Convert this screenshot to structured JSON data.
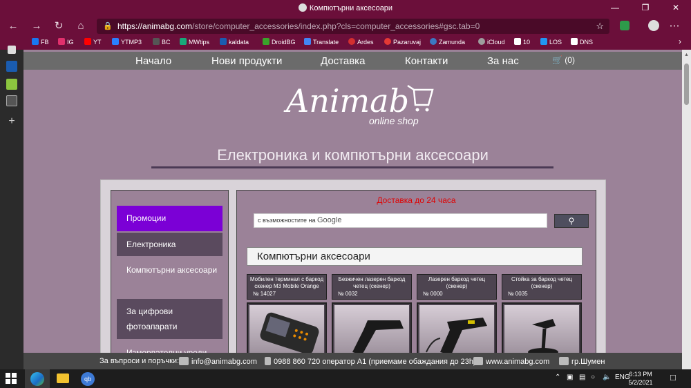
{
  "browser": {
    "tab_title": "Компютърни аксесоари",
    "url_host": "https://animabg.com",
    "url_path": "/store/computer_accessories/index.php?cls=computer_accessories#gsc.tab=0",
    "window_controls": [
      "—",
      "❐",
      "✕"
    ]
  },
  "favorites": [
    {
      "label": "FB",
      "color": "#1877f2"
    },
    {
      "label": "IG",
      "color": "#e1306c"
    },
    {
      "label": "YT",
      "color": "#ff0000"
    },
    {
      "label": "YTMP3",
      "color": "#2a7fff"
    },
    {
      "label": "BC",
      "color": "#555555"
    },
    {
      "label": "MWtips",
      "color": "#18a87a"
    },
    {
      "label": "kaldata",
      "color": "#1a5cb0"
    },
    {
      "label": "DroidBG",
      "color": "#3aa32a"
    },
    {
      "label": "Translate",
      "color": "#4285f4"
    },
    {
      "label": "Ardes",
      "color": "#d32f2f"
    },
    {
      "label": "Pazaruvaj",
      "color": "#e53935"
    },
    {
      "label": "Zamunda",
      "color": "#3b78c2"
    },
    {
      "label": "iCloud",
      "color": "#9e9e9e"
    },
    {
      "label": "10",
      "color": "#ffffff"
    },
    {
      "label": "LOS",
      "color": "#2196f3"
    },
    {
      "label": "DNS",
      "color": "#ffffff"
    }
  ],
  "site": {
    "menu": [
      "Начало",
      "Нови продукти",
      "Доставка",
      "Контакти",
      "За нас"
    ],
    "cart_count": "(0)",
    "logo_main": "Animab",
    "logo_sub": "online shop",
    "headline": "Електроника и компютърни аксесоари",
    "categories": [
      {
        "label": "Промоции",
        "active": true
      },
      {
        "label": "Електроника",
        "active": false
      },
      {
        "label": "Компютърни аксесоари",
        "active": false
      },
      {
        "label": "За цифрови фотоапарати",
        "active": false
      },
      {
        "label": "Измервателни уреди",
        "active": false
      }
    ],
    "delivery_note": "Доставка до 24 часа",
    "search_placeholder": "с възможностите на",
    "search_brand": "Google",
    "section_title": "Компютърни аксесоари",
    "products": [
      {
        "name": "Мобилен терминал с баркод скенер M3 Mobile Orange",
        "code": "№ 14027"
      },
      {
        "name": "Безжичен лазерен баркод четец (скенер)",
        "code": "№ 0032"
      },
      {
        "name": "Лазерен баркод четец (скенер)",
        "code": "№ 0000"
      },
      {
        "name": "Стойка за баркод четец (скенер)",
        "code": "№ 0035"
      }
    ]
  },
  "footer": {
    "questions": "За въпроси и поръчки:",
    "email": "info@animabg.com",
    "phone": "0988 860 720 оператор А1 (приемаме обаждания до 23h)",
    "website": "www.animabg.com",
    "city": "гр.Шумен"
  },
  "taskbar": {
    "language": "ENG",
    "time": "6:13 PM",
    "date": "5/2/2021"
  },
  "colors": {
    "browser_chrome": "#6b0f3a",
    "page_bg": "#9b8298",
    "active_category": "#7b00d6",
    "category_bg": "#5a4a5e",
    "delivery_red": "#e00000"
  }
}
